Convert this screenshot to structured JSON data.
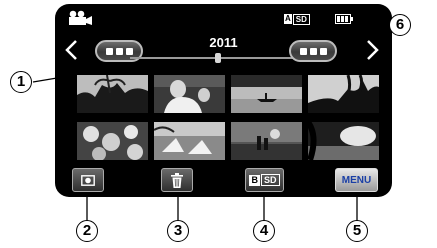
{
  "header": {
    "mode_icon": "video-camera-icon",
    "media_badge": {
      "slot": "A",
      "media": "SD"
    },
    "battery_icon": "battery-icon"
  },
  "navigation": {
    "prev_icon": "chevron-left-icon",
    "next_icon": "chevron-right-icon",
    "date_left_icon": "date-button-icon",
    "date_right_icon": "date-button-icon",
    "year": "2011"
  },
  "thumbnails": [
    {
      "scene": "palm trees"
    },
    {
      "scene": "person with child"
    },
    {
      "scene": "canoe on lake"
    },
    {
      "scene": "tree silhouette"
    },
    {
      "scene": "flowers"
    },
    {
      "scene": "beach chairs"
    },
    {
      "scene": "couple at sunset"
    },
    {
      "scene": "sunlit water"
    }
  ],
  "toolbar": {
    "record_icon": "record-icon",
    "delete_icon": "trash-icon",
    "media_switch": {
      "slot": "B",
      "media": "SD"
    },
    "menu_label": "MENU"
  },
  "callouts": {
    "c1": "1",
    "c2": "2",
    "c3": "3",
    "c4": "4",
    "c5": "5",
    "c6": "6"
  }
}
